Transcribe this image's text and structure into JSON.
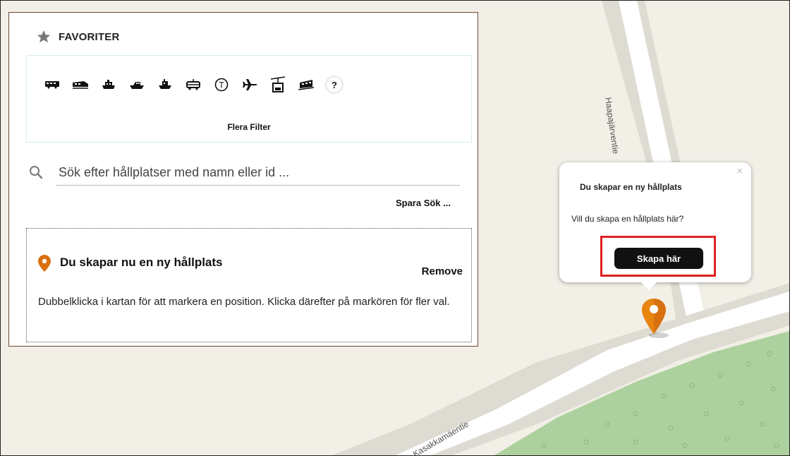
{
  "favorites": {
    "title": "FAVORITER",
    "icon": "star-icon"
  },
  "filters": {
    "icons": [
      "bus-icon",
      "train-icon",
      "ship-icon",
      "ferry-icon",
      "boat-icon",
      "tram-icon",
      "subway-icon",
      "airplane-icon",
      "cable-car-icon",
      "funicular-icon"
    ],
    "help_label": "?",
    "subway_letter": "T",
    "more_label": "Flera Filter"
  },
  "search": {
    "placeholder": "Sök efter hållplatser med namn eller id ...",
    "value": "",
    "save_label": "Spara Sök ..."
  },
  "new_stop": {
    "heading": "Du skapar nu en ny hållplats",
    "remove_label": "Remove",
    "description": "Dubbelklicka i kartan för att markera en position. Klicka därefter på markören för fler val."
  },
  "popup": {
    "close_label": "×",
    "title": "Du skapar en ny hållplats",
    "question": "Vill du skapa en hållplats här?",
    "button_label": "Skapa här"
  },
  "map": {
    "streets": [
      "Haapajärventie",
      "Kasakkamäentie"
    ]
  },
  "colors": {
    "accent_orange": "#d9700f",
    "highlight_red": "#e0201f",
    "panel_border": "#6b4a34",
    "map_bg": "#f1efe6",
    "forest": "#add19e"
  }
}
